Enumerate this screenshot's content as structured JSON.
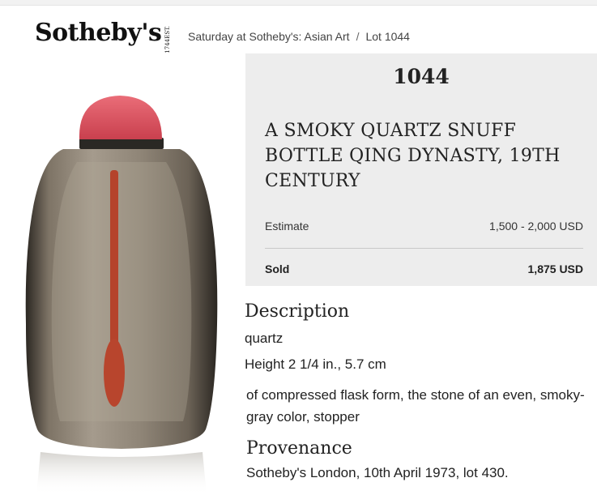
{
  "brand": {
    "name": "Sotheby's",
    "est_1": "EST.",
    "est_2": "1744"
  },
  "breadcrumb": {
    "sale": "Saturday at Sotheby's: Asian Art",
    "separator": "/",
    "lot": "Lot 1044"
  },
  "lot": {
    "number": "1044",
    "title": "A Smoky Quartz Snuff Bottle Qing Dynasty, 19th Century",
    "estimate_label": "Estimate",
    "estimate_value": "1,500 - 2,000 USD",
    "sold_label": "Sold",
    "sold_value": "1,875 USD"
  },
  "description": {
    "heading": "Description",
    "material": "quartz",
    "height": "Height 2 1/4  in., 5.7 cm",
    "text": "of compressed flask form, the stone of an even, smoky-gray color, stopper"
  },
  "provenance": {
    "heading": "Provenance",
    "text": "Sotheby's London, 10th April 1973, lot 430."
  },
  "colors": {
    "panel_bg": "#ededed",
    "stopper": "#d94f5c",
    "spoon": "#b5432b",
    "quartz": "#6f6558"
  }
}
